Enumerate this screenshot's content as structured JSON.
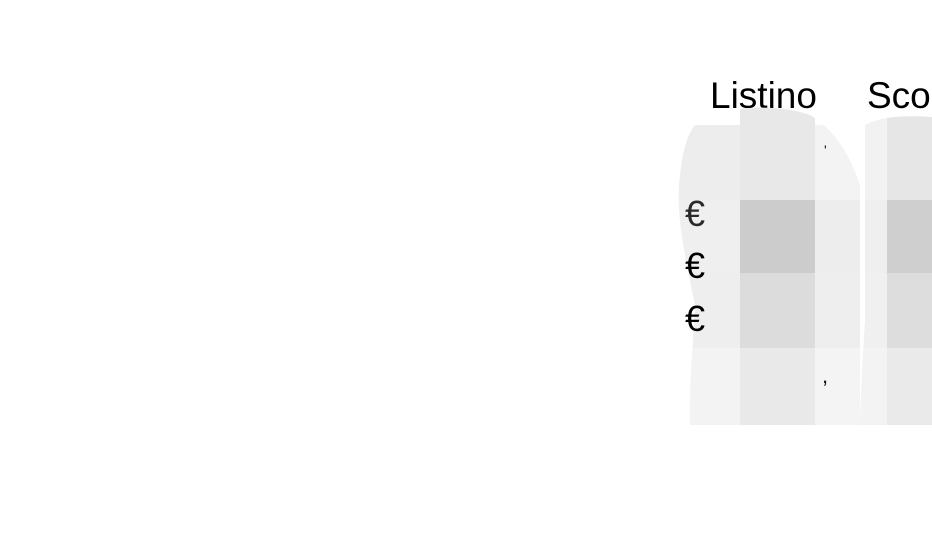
{
  "table": {
    "headers": [
      "Listino",
      "Sco"
    ],
    "currency_symbol": "€",
    "currency_rows": [
      "€",
      "€",
      "€"
    ]
  },
  "image": {
    "description_icon": "pixelated-grayscale-figure-icon"
  },
  "colors": {
    "background": "#ffffff",
    "text": "#000000",
    "pixel_light": "#f2f2f2",
    "pixel_mid": "#e6e6e6",
    "pixel_dark": "#cccccc"
  }
}
